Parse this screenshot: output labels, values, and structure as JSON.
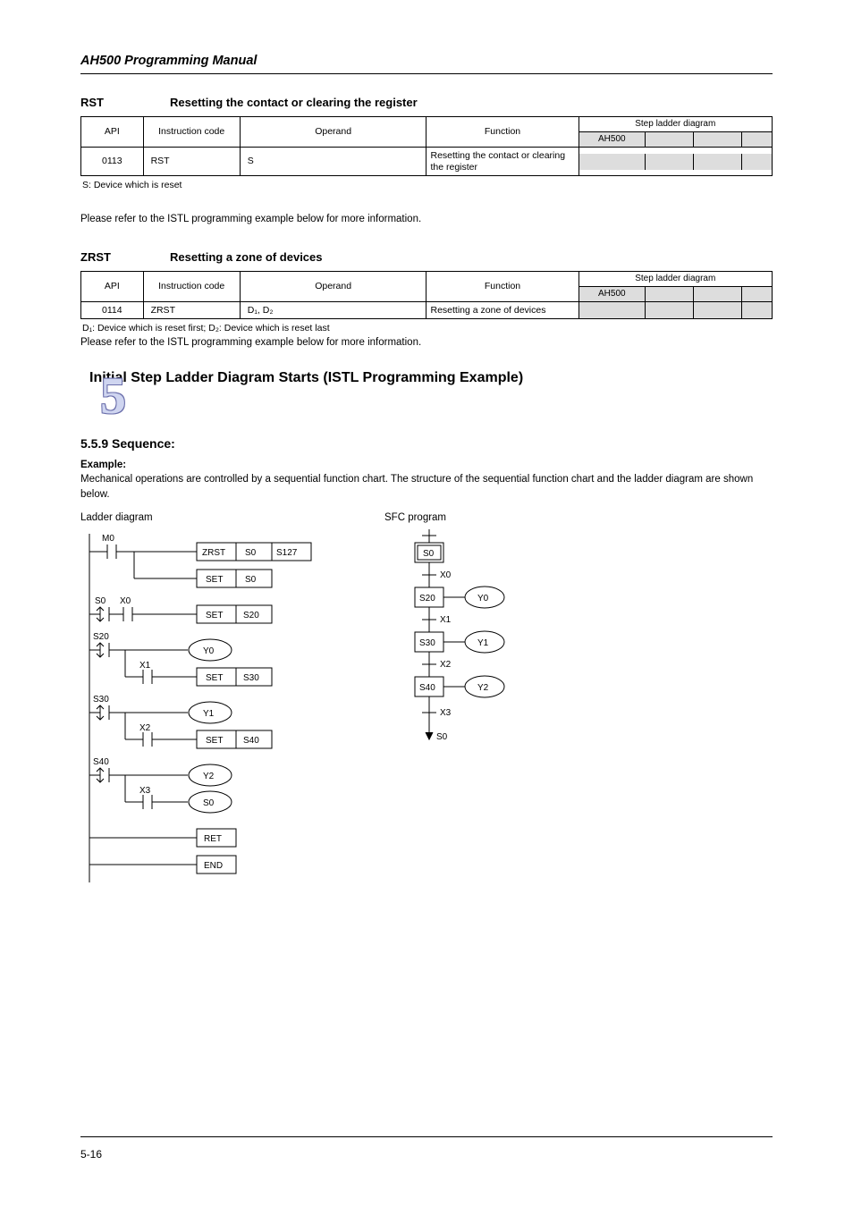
{
  "header_title": "AH500 Programming Manual",
  "instr1": {
    "mnemonic": "RST",
    "name": "Resetting the contact or clearing the register",
    "cols": [
      "API",
      "Instruction code",
      "Operand",
      "Function"
    ],
    "st_head": "Step ladder diagram",
    "st_cells": [
      "AH500",
      "",
      "",
      ""
    ],
    "row": [
      "0113",
      "RST",
      "S",
      "Resetting the contact or clearing the register"
    ]
  },
  "notebelow": "S: Device which is reset",
  "desc": "Please refer to the ISTL programming example below for more information.",
  "instr2": {
    "mnemonic": "ZRST",
    "name": "Resetting a zone of devices",
    "cols": [
      "API",
      "Instruction code",
      "Operand",
      "Function"
    ],
    "st_head": "Step ladder diagram",
    "st_cells": [
      "AH500",
      "",
      "",
      ""
    ],
    "row": [
      "0114",
      "ZRST",
      "D₁, D₂",
      "Resetting a zone of devices"
    ]
  },
  "notes2": [
    "D₁: Device which is reset first; D₂: Device which is reset last",
    "Please refer to the ISTL programming example below for more information."
  ],
  "section": {
    "num": "5",
    "big_title": "Initial Step Ladder Diagram Starts (ISTL Programming Example)",
    "sub_title": "5.5.9 Sequence:"
  },
  "example": {
    "label": "Example:",
    "text": "Mechanical operations are controlled by a sequential function chart. The structure of the sequential function chart and the ladder diagram are shown below."
  },
  "captions": {
    "ladder": "Ladder diagram",
    "sfc": "SFC program"
  },
  "chart_data": {
    "type": "diagram-pair",
    "ladder": {
      "rungs": [
        {
          "contacts": [
            "M0"
          ],
          "outputs": [
            {
              "type": "box",
              "w": 3,
              "cells": [
                "ZRST",
                "S0",
                "S127"
              ]
            }
          ]
        },
        {
          "contacts": [],
          "outputs": [
            {
              "type": "box",
              "w": 2,
              "cells": [
                "SET",
                "S0"
              ]
            }
          ]
        },
        {
          "contacts": [
            {
              "type": "step",
              "label": "S0"
            },
            {
              "type": "no",
              "label": "X0"
            }
          ],
          "outputs": [
            {
              "type": "box",
              "w": 2,
              "cells": [
                "SET",
                "S20"
              ]
            }
          ]
        },
        {
          "contacts": [
            {
              "type": "step",
              "label": "S20"
            }
          ],
          "outputs": [
            {
              "type": "coil",
              "label": "Y0"
            }
          ]
        },
        {
          "contacts": [
            {
              "type": "branch"
            },
            {
              "type": "no",
              "label": "X1"
            }
          ],
          "outputs": [
            {
              "type": "box",
              "w": 2,
              "cells": [
                "SET",
                "S30"
              ]
            }
          ]
        },
        {
          "contacts": [
            {
              "type": "step",
              "label": "S30"
            }
          ],
          "outputs": [
            {
              "type": "coil",
              "label": "Y1"
            }
          ]
        },
        {
          "contacts": [
            {
              "type": "branch"
            },
            {
              "type": "no",
              "label": "X2"
            }
          ],
          "outputs": [
            {
              "type": "box",
              "w": 2,
              "cells": [
                "SET",
                "S40"
              ]
            }
          ]
        },
        {
          "contacts": [
            {
              "type": "step",
              "label": "S40"
            }
          ],
          "outputs": [
            {
              "type": "coil",
              "label": "Y2"
            }
          ]
        },
        {
          "contacts": [
            {
              "type": "branch"
            },
            {
              "type": "no",
              "label": "X3"
            }
          ],
          "outputs": [
            {
              "type": "coil",
              "label": "S0"
            }
          ]
        },
        {
          "contacts": [],
          "outputs": [
            {
              "type": "box",
              "w": 1,
              "cells": [
                "RET"
              ]
            }
          ]
        },
        {
          "contacts": [],
          "outputs": [
            {
              "type": "box",
              "w": 1,
              "cells": [
                "END"
              ]
            }
          ]
        }
      ]
    },
    "sfc": {
      "steps": [
        {
          "name": "S0",
          "initial": true,
          "trans": "X0",
          "action": null
        },
        {
          "name": "S20",
          "initial": false,
          "trans": "X1",
          "action": "Y0"
        },
        {
          "name": "S30",
          "initial": false,
          "trans": "X2",
          "action": "Y1"
        },
        {
          "name": "S40",
          "initial": false,
          "trans": "X3",
          "action": "Y2"
        }
      ],
      "loop_back_to": "S0"
    }
  },
  "footer": {
    "left": "5-16",
    "right": ""
  }
}
